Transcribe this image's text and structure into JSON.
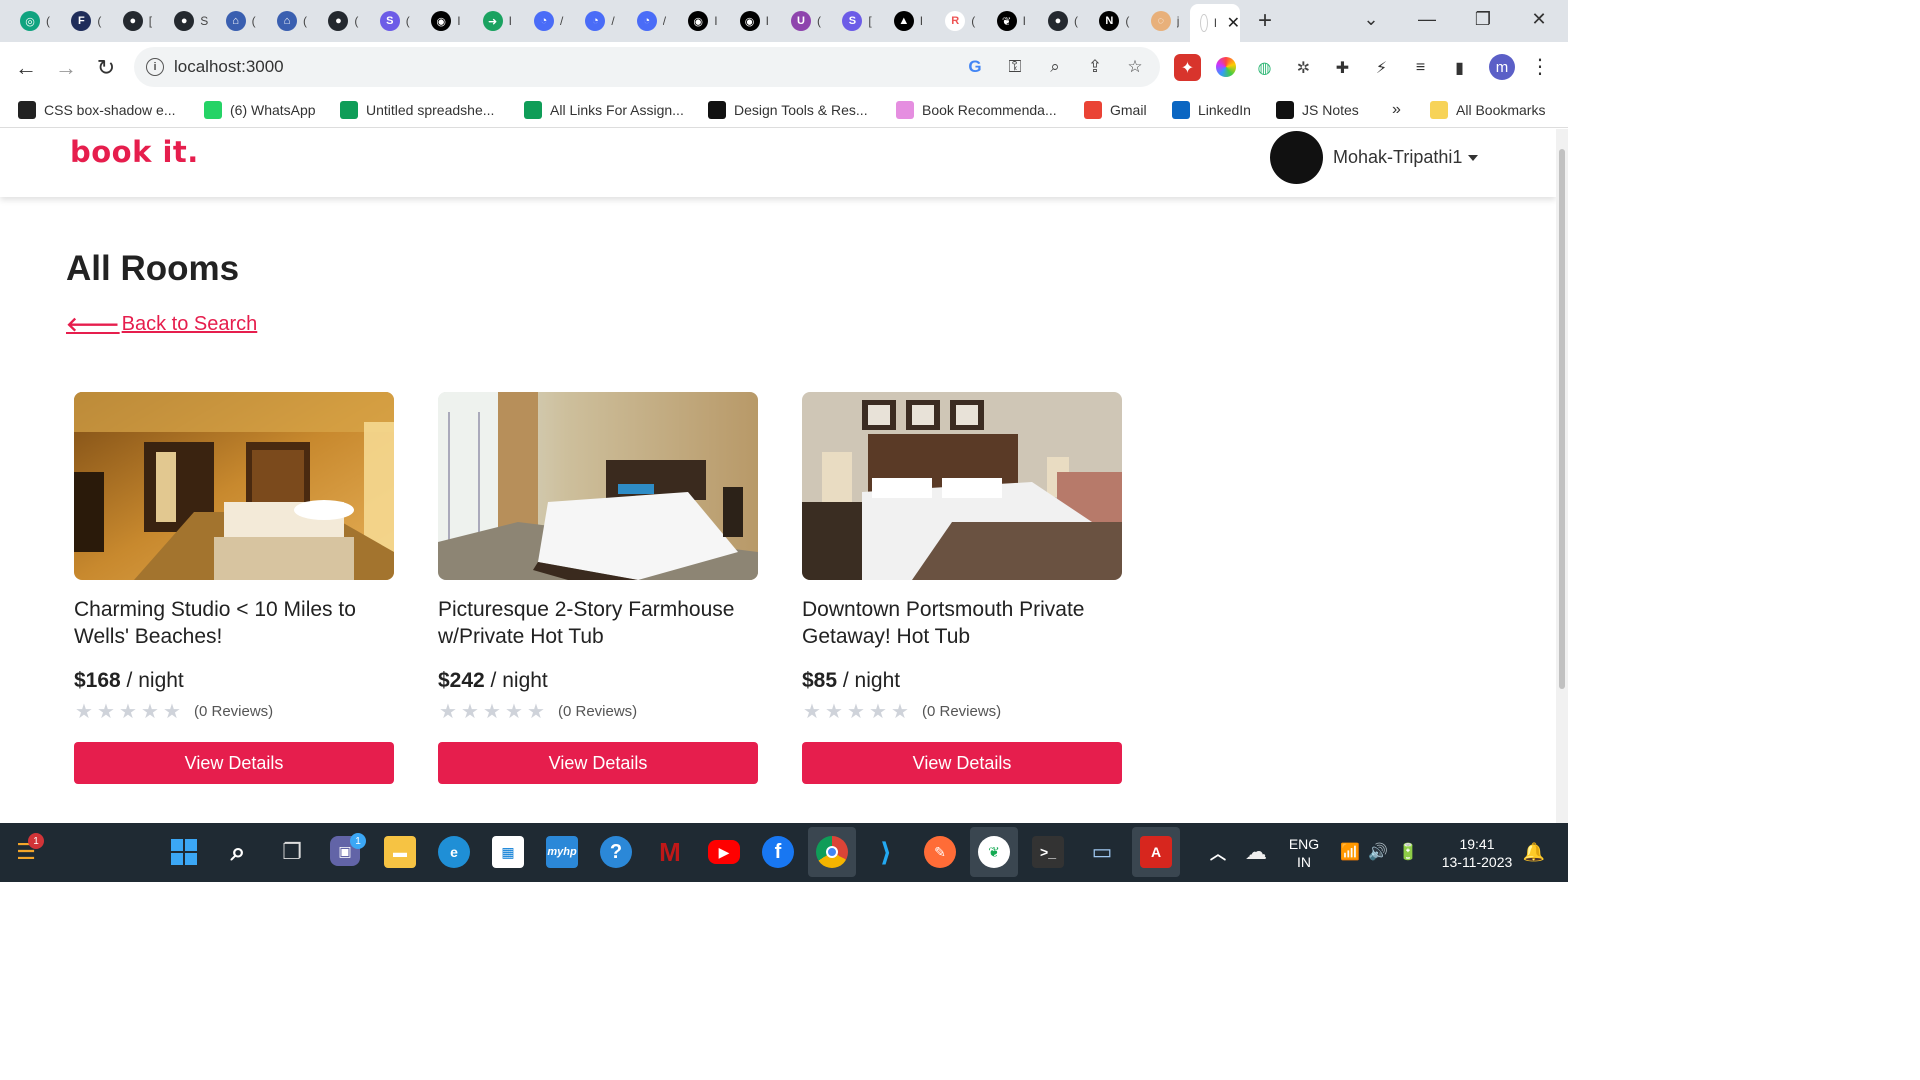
{
  "browser": {
    "tabs": [
      {
        "icon": "chatgpt-icon",
        "color": "#10a37f",
        "glyph": "◎",
        "clip": "("
      },
      {
        "icon": "f-icon",
        "color": "#1f2d5a",
        "glyph": "F",
        "clip": "("
      },
      {
        "icon": "github-icon",
        "color": "#24292f",
        "glyph": "●",
        "clip": "["
      },
      {
        "icon": "github-icon",
        "color": "#24292f",
        "glyph": "●",
        "clip": "S"
      },
      {
        "icon": "bank-icon",
        "color": "#3a5fb0",
        "glyph": "⌂",
        "clip": "("
      },
      {
        "icon": "bank-icon",
        "color": "#3a5fb0",
        "glyph": "⌂",
        "clip": "("
      },
      {
        "icon": "github-icon",
        "color": "#24292f",
        "glyph": "●",
        "clip": "("
      },
      {
        "icon": "s-icon",
        "color": "#6c5ce7",
        "glyph": "S",
        "clip": "("
      },
      {
        "icon": "tool-icon",
        "color": "#000000",
        "glyph": "◉",
        "clip": "I"
      },
      {
        "icon": "share-icon",
        "color": "#1aa260",
        "glyph": "➜",
        "clip": "I"
      },
      {
        "icon": "chat-icon",
        "color": "#4a6cf7",
        "glyph": "◔",
        "clip": "/"
      },
      {
        "icon": "chat-icon",
        "color": "#4a6cf7",
        "glyph": "◔",
        "clip": "/"
      },
      {
        "icon": "chat-icon",
        "color": "#4a6cf7",
        "glyph": "◔",
        "clip": "/"
      },
      {
        "icon": "tool-icon",
        "color": "#000000",
        "glyph": "◉",
        "clip": "I"
      },
      {
        "icon": "tool-icon",
        "color": "#000000",
        "glyph": "◉",
        "clip": "I"
      },
      {
        "icon": "u-icon",
        "color": "#8e44ad",
        "glyph": "U",
        "clip": "("
      },
      {
        "icon": "s-icon",
        "color": "#6c5ce7",
        "glyph": "S",
        "clip": "["
      },
      {
        "icon": "triangle-icon",
        "color": "#000000",
        "glyph": "▲",
        "clip": "I"
      },
      {
        "icon": "r-icon",
        "color": "#ffffff",
        "glyph": "R",
        "clip": "("
      },
      {
        "icon": "mongodb-icon",
        "color": "#000000",
        "glyph": "❦",
        "clip": "I"
      },
      {
        "icon": "github-icon",
        "color": "#24292f",
        "glyph": "●",
        "clip": "("
      },
      {
        "icon": "n-icon",
        "color": "#000000",
        "glyph": "N",
        "clip": "("
      },
      {
        "icon": "loading-icon",
        "color": "#e8b07a",
        "glyph": "◌",
        "clip": "j"
      }
    ],
    "active_tab_clip": "I",
    "url": "localhost:3000"
  },
  "bookmarks": [
    {
      "label": "CSS box-shadow e...",
      "icon": "css-icon",
      "color": "#222"
    },
    {
      "label": "(6) WhatsApp",
      "icon": "whatsapp-icon",
      "color": "#25d366"
    },
    {
      "label": "Untitled spreadshe...",
      "icon": "sheets-icon",
      "color": "#0f9d58"
    },
    {
      "label": "All Links For Assign...",
      "icon": "sheets-icon",
      "color": "#0f9d58"
    },
    {
      "label": "Design Tools & Res...",
      "icon": "notion-icon",
      "color": "#111"
    },
    {
      "label": "Book Recommenda...",
      "icon": "bookmark-stripe-icon",
      "color": "#e58ee0"
    },
    {
      "label": "Gmail",
      "icon": "gmail-icon",
      "color": "#ea4335"
    },
    {
      "label": "LinkedIn",
      "icon": "linkedin-icon",
      "color": "#0a66c2"
    },
    {
      "label": "JS Notes",
      "icon": "notion-icon",
      "color": "#111"
    }
  ],
  "bookmarks_overflow": "»",
  "all_bookmarks": "All Bookmarks",
  "site": {
    "logo": "book it.",
    "user_name": "Mohak-Tripathi1",
    "page_title": "All Rooms",
    "back_link": "Back to Search"
  },
  "rooms": [
    {
      "name": "Charming Studio < 10 Miles to Wells' Beaches!",
      "price": "$168",
      "per": " / night",
      "reviews": "(0 Reviews)",
      "stars": 0,
      "button": "View Details"
    },
    {
      "name": "Picturesque 2-Story Farmhouse w/Private Hot Tub",
      "price": "$242",
      "per": " / night",
      "reviews": "(0 Reviews)",
      "stars": 0,
      "button": "View Details"
    },
    {
      "name": "Downtown Portsmouth Private Getaway! Hot Tub",
      "price": "$85",
      "per": " / night",
      "reviews": "(0 Reviews)",
      "stars": 0,
      "button": "View Details"
    }
  ],
  "taskbar": {
    "lang_top": "ENG",
    "lang_bottom": "IN",
    "time": "19:41",
    "date": "13-11-2023",
    "weather_badge": "1",
    "teams_badge": "1"
  },
  "colors": {
    "accent": "#e61e4d"
  }
}
